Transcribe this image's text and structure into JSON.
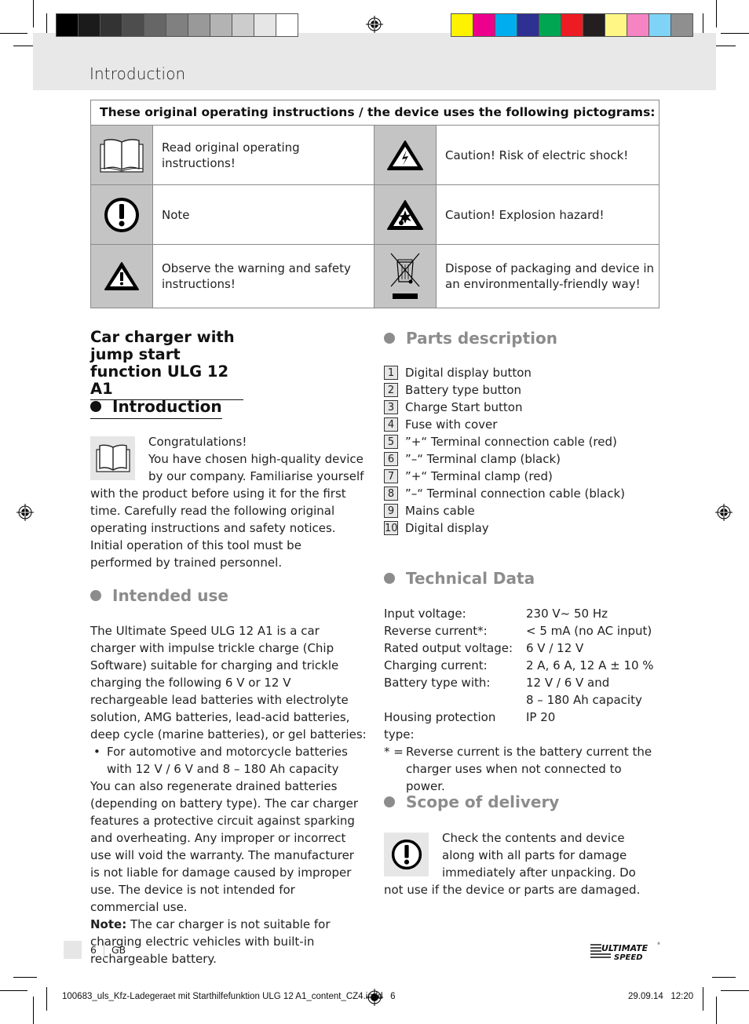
{
  "page": {
    "section_header": "Introduction",
    "page_number": "6",
    "language": "GB",
    "footer_file": "100683_uls_Kfz-Ladegeraet mit Starthilfefunktion ULG 12 A1_content_CZ4.indd   6",
    "footer_datetime": "29.09.14   12:20",
    "brand_logo": "Ultimate Speed"
  },
  "colors": {
    "grayscale_bar": [
      "#000000",
      "#1b1b1b",
      "#333333",
      "#4d4d4d",
      "#666666",
      "#808080",
      "#999999",
      "#b3b3b3",
      "#cccccc",
      "#e6e6e6",
      "#ffffff"
    ],
    "color_bar": [
      "#fff200",
      "#ec008c",
      "#00aeef",
      "#2e3192",
      "#00a651",
      "#ed1c24",
      "#231f20",
      "#fff685",
      "#f484c4",
      "#7fd3f7",
      "#8f8f8f"
    ],
    "header_band": "#e8e8e8",
    "icon_cell": "#c4c4c4",
    "grey_heading": "#8c8c8c"
  },
  "pictograms": {
    "title": "These original operating instructions / the device uses the following pictograms:",
    "rows": [
      {
        "left": {
          "icon": "book-icon",
          "text": "Read original operating instructions!"
        },
        "right": {
          "icon": "electric-shock-icon",
          "text": "Caution! Risk of electric shock!"
        }
      },
      {
        "left": {
          "icon": "note-icon",
          "text": "Note"
        },
        "right": {
          "icon": "explosion-icon",
          "text": "Caution! Explosion hazard!"
        }
      },
      {
        "left": {
          "icon": "warning-icon",
          "text": "Observe the warning and safety instructions!"
        },
        "right": {
          "icon": "recycling-bin-icon",
          "text": "Dispose of packaging and device in an environmentally-friendly way!"
        }
      }
    ]
  },
  "product_title": "Car charger with jump start function ULG 12 A1",
  "introduction": {
    "heading": "Introduction",
    "text_first": "Congratulations!",
    "text_body": "You have chosen high-quality device by our company. Familiarise yourself with the product before using it for the first time. Carefully read the following original operating instructions and safety notices. Initial operation of this tool must be performed by trained personnel."
  },
  "intended_use": {
    "heading": "Intended use",
    "para1": "The Ultimate Speed ULG 12 A1 is a car charger with impulse trickle charge (Chip Software) suitable for charging and trickle charging the following 6 V or 12 V rechargeable lead batteries with electrolyte solution, AMG batteries, lead-acid batteries, deep cycle (marine batteries), or gel batteries:",
    "bullet": "For automotive and motorcycle batteries with 12 V / 6 V and 8 – 180 Ah capacity",
    "para2": "You can also regenerate drained batteries (depending on battery type). The car charger features a protective circuit against sparking and overheating. Any improper or incorrect use will void the warranty. The manufacturer is not liable for damage caused by improper use. The device is not intended for commercial use.",
    "note_label": "Note:",
    "note_text": " The car charger is not suitable for charging electric vehicles with built-in rechargeable battery."
  },
  "parts_description": {
    "heading": "Parts description",
    "items": [
      {
        "num": "1",
        "label": "Digital display button"
      },
      {
        "num": "2",
        "label": "Battery type button"
      },
      {
        "num": "3",
        "label": "Charge Start button"
      },
      {
        "num": "4",
        "label": "Fuse with cover"
      },
      {
        "num": "5",
        "label": "”+“ Terminal connection cable (red)"
      },
      {
        "num": "6",
        "label": "”–“ Terminal clamp (black)"
      },
      {
        "num": "7",
        "label": "”+“ Terminal clamp (red)"
      },
      {
        "num": "8",
        "label": "”–“ Terminal connection cable (black)"
      },
      {
        "num": "9",
        "label": "Mains cable"
      },
      {
        "num": "10",
        "label": "Digital display"
      }
    ]
  },
  "technical_data": {
    "heading": "Technical Data",
    "rows": [
      {
        "key": "Input voltage:",
        "value": "230 V~ 50 Hz"
      },
      {
        "key": "Reverse current*:",
        "value": "< 5 mA (no AC input)"
      },
      {
        "key": "Rated output voltage:",
        "value": "6 V / 12 V"
      },
      {
        "key": "Charging current:",
        "value": "2 A, 6 A, 12 A ± 10 %"
      },
      {
        "key": "Battery type with:",
        "value": "12 V / 6 V and"
      },
      {
        "key": "",
        "value": "8 – 180 Ah capacity"
      },
      {
        "key": "Housing protection type:",
        "value": "IP 20"
      }
    ],
    "footnote_mark": "* =",
    "footnote": "Reverse current is the battery current the charger uses when not connected to power."
  },
  "scope_of_delivery": {
    "heading": "Scope of delivery",
    "text": "Check the contents and device along with all parts for damage immediately after unpacking. Do not use if the device or parts are damaged."
  }
}
